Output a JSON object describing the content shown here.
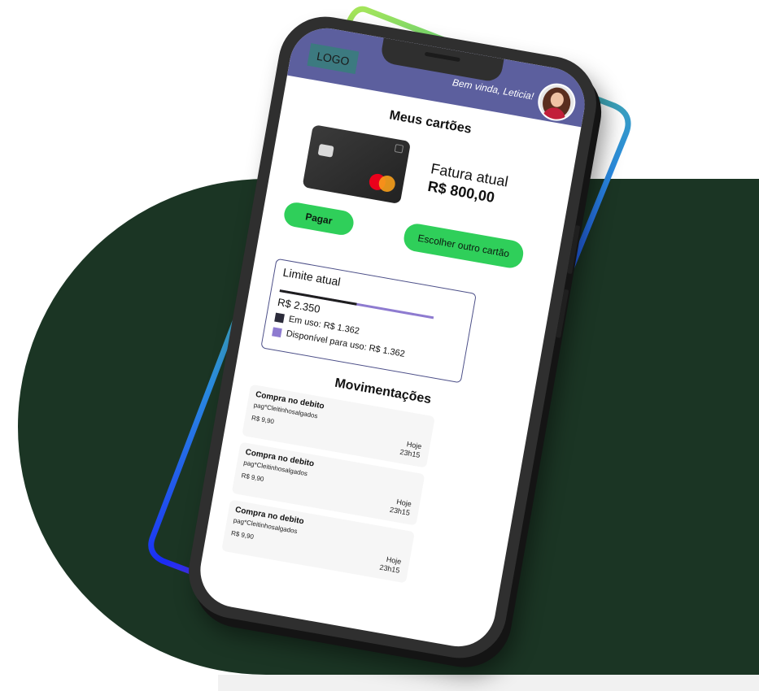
{
  "header": {
    "logo": "LOGO",
    "greeting": "Bem vinda, Leticia!"
  },
  "cards_section": {
    "title": "Meus cartões",
    "fatura_label": "Fatura atual",
    "fatura_value": "R$ 800,00"
  },
  "buttons": {
    "pay": "Pagar",
    "choose_card": "Escolher outro cartão"
  },
  "limit": {
    "title": "Limite atual",
    "total": "R$ 2.350",
    "used_label": "Em uso: R$ 1.362",
    "available_label": "Disponível para uso: R$ 1.362",
    "used_fraction": 0.5
  },
  "movements": {
    "title": "Movimentações",
    "items": [
      {
        "title": "Compra no debito",
        "merchant": "pag*Cleitinhosalgados",
        "amount": "R$ 9,90",
        "day": "Hoje",
        "time": "23h15"
      },
      {
        "title": "Compra no debito",
        "merchant": "pag*Cleitinhosalgados",
        "amount": "R$ 9,90",
        "day": "Hoje",
        "time": "23h15"
      },
      {
        "title": "Compra no debito",
        "merchant": "pag*Cleitinhosalgados",
        "amount": "R$ 9,90",
        "day": "Hoje",
        "time": "23h15"
      }
    ]
  },
  "colors": {
    "background_dark": "#1b3524",
    "header": "#5c5f9e",
    "button": "#2fcf5a",
    "available": "#8e7bd0",
    "used": "#2b2b3a"
  }
}
